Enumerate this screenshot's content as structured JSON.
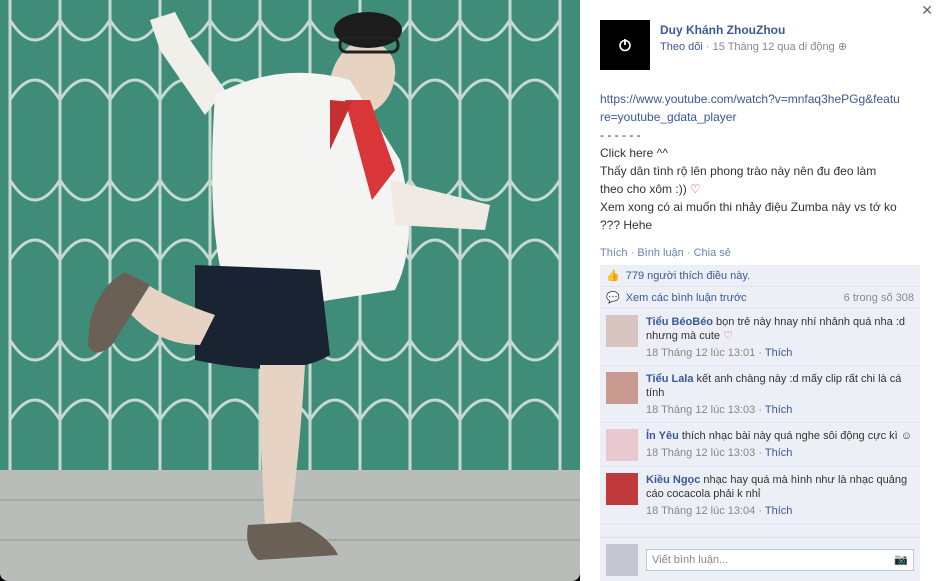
{
  "photo": {
    "alt_colors": {
      "wall": "#3f8d78",
      "shirt": "#f4f4f2",
      "shorts": "#1a2331",
      "scarf": "#d9363a"
    }
  },
  "post": {
    "author": "Duy Khánh ZhouZhou",
    "follow": "Theo dõi",
    "dot": "·",
    "timestamp": "15 Tháng 12 qua di động",
    "link": "https://www.youtube.com/watch?v=mnfaq3hePGg&feature=youtube_gdata_player",
    "dashes": "- - - - - -",
    "line1": "Click here ^^",
    "line2": "Thấy dân tình rộ lên phong trào này nên đu đeo làm theo cho xôm :))",
    "line3": "Xem xong có ai muốn thi nhảy điệu Zumba này vs tớ ko ??? Hehe"
  },
  "actions": {
    "like": "Thích",
    "comment": "Bình luận",
    "share": "Chia sẻ",
    "sep": "·"
  },
  "likes": {
    "text": "779 người thích điều này."
  },
  "more": {
    "text": "Xem các bình luận trước",
    "count": "6 trong số 308"
  },
  "comments": [
    {
      "name": "Tiểu BéoBéo",
      "text": "bọn trẻ này hnay nhí nhảnh quá nha :d nhưng mà cute",
      "time": "18 Tháng 12 lúc 13:01",
      "like": "Thích"
    },
    {
      "name": "Tiểu Lala",
      "text": "kết anh chàng này :d mấy clip rất chi là cá tính",
      "time": "18 Tháng 12 lúc 13:03",
      "like": "Thích"
    },
    {
      "name": "Ỉn Yêu",
      "text": "thích nhạc bài này quá nghe sôi động cực kì",
      "time": "18 Tháng 12 lúc 13:03",
      "like": "Thích"
    },
    {
      "name": "Kiều Ngọc",
      "text": "nhạc hay quá mà hình như là nhạc quảng cáo cocacola phải k nhỉ",
      "time": "18 Tháng 12 lúc 13:04",
      "like": "Thích"
    }
  ],
  "writer": {
    "placeholder": "Viết bình luận..."
  }
}
